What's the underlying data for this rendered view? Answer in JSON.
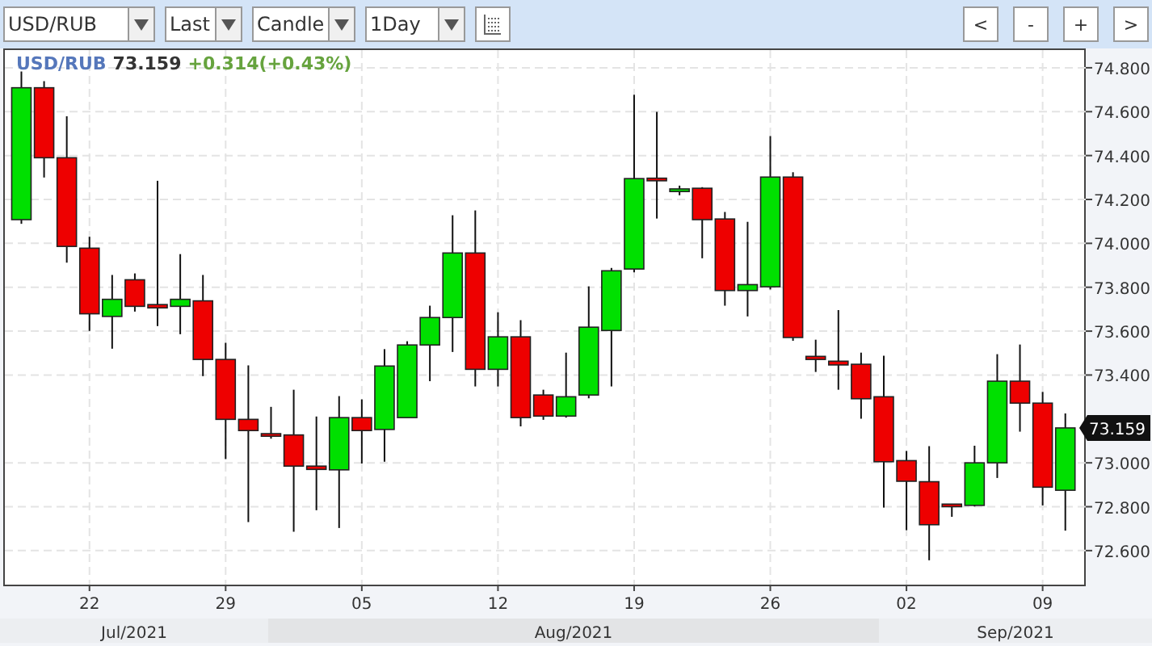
{
  "toolbar": {
    "dropdowns": [
      {
        "value": "USD/RUB"
      },
      {
        "value": "Last"
      },
      {
        "value": "Candle"
      },
      {
        "value": "1Day"
      }
    ],
    "nav_buttons": [
      "<",
      "-",
      "+",
      ">"
    ]
  },
  "legend": {
    "symbol": "USD/RUB",
    "price": "73.159",
    "change": "+0.314(+0.43%)"
  },
  "last_price_marker": "73.159",
  "month_bar": [
    "Jul/2021",
    "Aug/2021",
    "Sep/2021"
  ],
  "chart_data": {
    "type": "candlestick",
    "grid": true,
    "ylim": [
      72.445,
      74.888
    ],
    "yticks": [
      {
        "value": 74.8,
        "label": "74.800"
      },
      {
        "value": 74.6,
        "label": "74.600"
      },
      {
        "value": 74.4,
        "label": "74.400"
      },
      {
        "value": 74.2,
        "label": "74.200"
      },
      {
        "value": 74.0,
        "label": "74.000"
      },
      {
        "value": 73.8,
        "label": "73.800"
      },
      {
        "value": 73.6,
        "label": "73.600"
      },
      {
        "value": 73.4,
        "label": "73.400"
      },
      {
        "value": 73.0,
        "label": "73.000"
      },
      {
        "value": 72.8,
        "label": "72.800"
      },
      {
        "value": 72.6,
        "label": "72.600"
      }
    ],
    "categories": [
      null,
      null,
      null,
      "22",
      null,
      null,
      null,
      null,
      null,
      "29",
      null,
      null,
      null,
      null,
      null,
      "05",
      null,
      null,
      null,
      null,
      null,
      "12",
      null,
      null,
      null,
      null,
      null,
      "19",
      null,
      null,
      null,
      null,
      null,
      "26",
      null,
      null,
      null,
      null,
      null,
      "02",
      null,
      null,
      null,
      null,
      null,
      "09",
      null
    ],
    "ohlc": [
      [
        74.108,
        74.783,
        74.089,
        74.709
      ],
      [
        74.709,
        74.739,
        74.3,
        74.39
      ],
      [
        74.39,
        74.579,
        73.912,
        73.986
      ],
      [
        73.978,
        74.03,
        73.601,
        73.679
      ],
      [
        73.667,
        73.856,
        73.52,
        73.745
      ],
      [
        73.834,
        73.863,
        73.689,
        73.713
      ],
      [
        73.721,
        74.285,
        73.623,
        73.706
      ],
      [
        73.713,
        73.951,
        73.586,
        73.745
      ],
      [
        73.738,
        73.856,
        73.395,
        73.471
      ],
      [
        73.471,
        73.547,
        73.017,
        73.198
      ],
      [
        73.198,
        73.444,
        72.73,
        73.147
      ],
      [
        73.128,
        73.255,
        73.11,
        73.126
      ],
      [
        73.127,
        73.333,
        72.686,
        72.985
      ],
      [
        72.985,
        73.211,
        72.784,
        72.97
      ],
      [
        72.968,
        73.304,
        72.703,
        73.206
      ],
      [
        73.206,
        73.289,
        72.997,
        73.147
      ],
      [
        73.152,
        73.518,
        73.005,
        73.441
      ],
      [
        73.206,
        73.554,
        73.206,
        73.537
      ],
      [
        73.537,
        73.716,
        73.372,
        73.662
      ],
      [
        73.662,
        74.128,
        73.505,
        73.956
      ],
      [
        73.956,
        74.15,
        73.348,
        73.426
      ],
      [
        73.426,
        73.686,
        73.348,
        73.574
      ],
      [
        73.574,
        73.65,
        73.166,
        73.206
      ],
      [
        73.309,
        73.333,
        73.196,
        73.213
      ],
      [
        73.213,
        73.502,
        73.206,
        73.301
      ],
      [
        73.309,
        73.804,
        73.294,
        73.618
      ],
      [
        73.603,
        73.888,
        73.348,
        73.875
      ],
      [
        73.883,
        74.677,
        73.868,
        74.295
      ],
      [
        74.292,
        74.599,
        74.113,
        74.29
      ],
      [
        74.236,
        74.263,
        74.219,
        74.248
      ],
      [
        74.251,
        74.256,
        73.932,
        74.108
      ],
      [
        74.111,
        74.143,
        73.716,
        73.785
      ],
      [
        73.785,
        74.098,
        73.667,
        73.812
      ],
      [
        73.802,
        74.489,
        73.79,
        74.302
      ],
      [
        74.302,
        74.324,
        73.556,
        73.571
      ],
      [
        73.485,
        73.561,
        73.414,
        73.471
      ],
      [
        73.463,
        73.696,
        73.333,
        73.446
      ],
      [
        73.449,
        73.502,
        73.201,
        73.292
      ],
      [
        73.301,
        73.488,
        72.796,
        73.005
      ],
      [
        73.01,
        73.054,
        72.693,
        72.916
      ],
      [
        72.914,
        73.076,
        72.556,
        72.718
      ],
      [
        72.806,
        72.806,
        72.754,
        72.806
      ],
      [
        72.806,
        73.078,
        72.801,
        73.0
      ],
      [
        73.0,
        73.495,
        72.931,
        73.372
      ],
      [
        73.372,
        73.539,
        73.142,
        73.272
      ],
      [
        73.272,
        73.323,
        72.806,
        72.889
      ],
      [
        72.875,
        73.225,
        72.691,
        73.159
      ]
    ]
  }
}
